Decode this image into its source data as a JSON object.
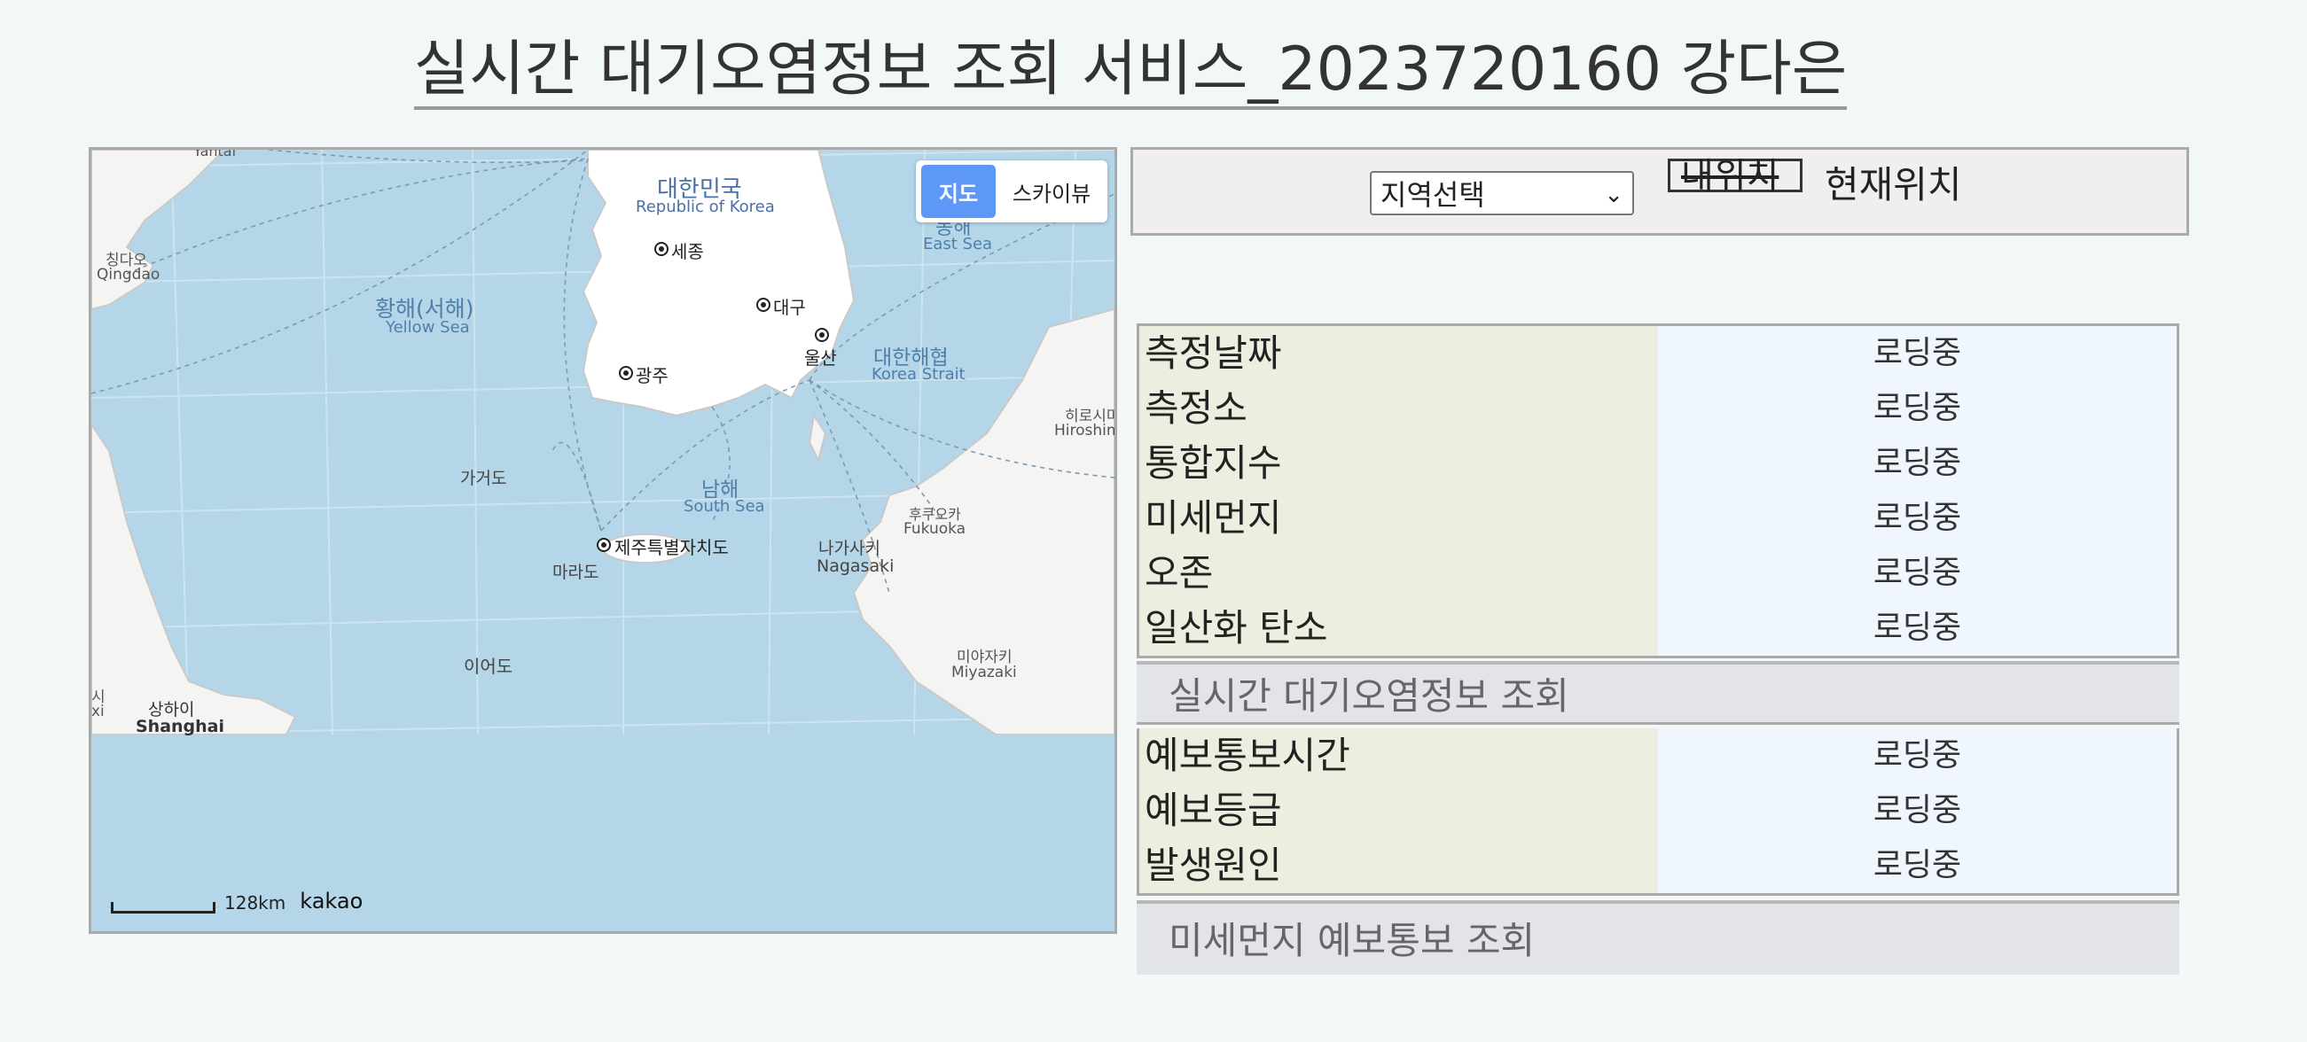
{
  "page": {
    "title": "실시간 대기오염정보 조회 서비스_2023720160 강다은"
  },
  "map": {
    "type_map_label": "지도",
    "type_sky_label": "스카이뷰",
    "scale_label": "128km",
    "logo": "kakao",
    "labels": {
      "korea": "대한민국",
      "korea_en": "Republic of Korea",
      "east_sea": "동해",
      "east_sea_en": "East Sea",
      "yellow_sea": "황해(서해)",
      "yellow_sea_en": "Yellow Sea",
      "sejong": "세종",
      "daegu": "대구",
      "ulsan": "울산",
      "gwangju": "광주",
      "korea_strait": "대한해협",
      "korea_strait_en": "Korea Strait",
      "qingdao": "칭다오",
      "qingdao_en": "Qingdao",
      "hiroshima": "히로시마",
      "hiroshima_en": "Hiroshima",
      "gageodo": "가거도",
      "south_sea": "남해",
      "south_sea_en": "South Sea",
      "fukuoka": "후쿠오카",
      "fukuoka_en": "Fukuoka",
      "jeju": "제주특별자치도",
      "marado": "마라도",
      "nagasaki": "나가사키",
      "nagasaki_en": "Nagasaki",
      "miyazaki": "미야자키",
      "miyazaki_en": "Miyazaki",
      "ieodo": "이어도",
      "shanghai": "상하이",
      "shanghai_en": "Shanghai",
      "suzhou_partial": "시",
      "suzhou_partial_en": "xi",
      "yantai_partial": "Yantai"
    }
  },
  "controls": {
    "region_select_value": "지역선택",
    "my_location_label": "내위치",
    "current_location_label": "현재위치"
  },
  "air_quality": {
    "rows": [
      {
        "label": "측정날짜",
        "value": "로딩중"
      },
      {
        "label": "측정소",
        "value": "로딩중"
      },
      {
        "label": "통합지수",
        "value": "로딩중"
      },
      {
        "label": "미세먼지",
        "value": "로딩중"
      },
      {
        "label": "오존",
        "value": "로딩중"
      },
      {
        "label": "일산화 탄소",
        "value": "로딩중"
      }
    ],
    "caption": "실시간 대기오염정보 조회"
  },
  "forecast": {
    "rows": [
      {
        "label": "예보통보시간",
        "value": "로딩중"
      },
      {
        "label": "예보등급",
        "value": "로딩중"
      },
      {
        "label": "발생원인",
        "value": "로딩중"
      }
    ],
    "caption": "미세먼지 예보통보 조회"
  }
}
